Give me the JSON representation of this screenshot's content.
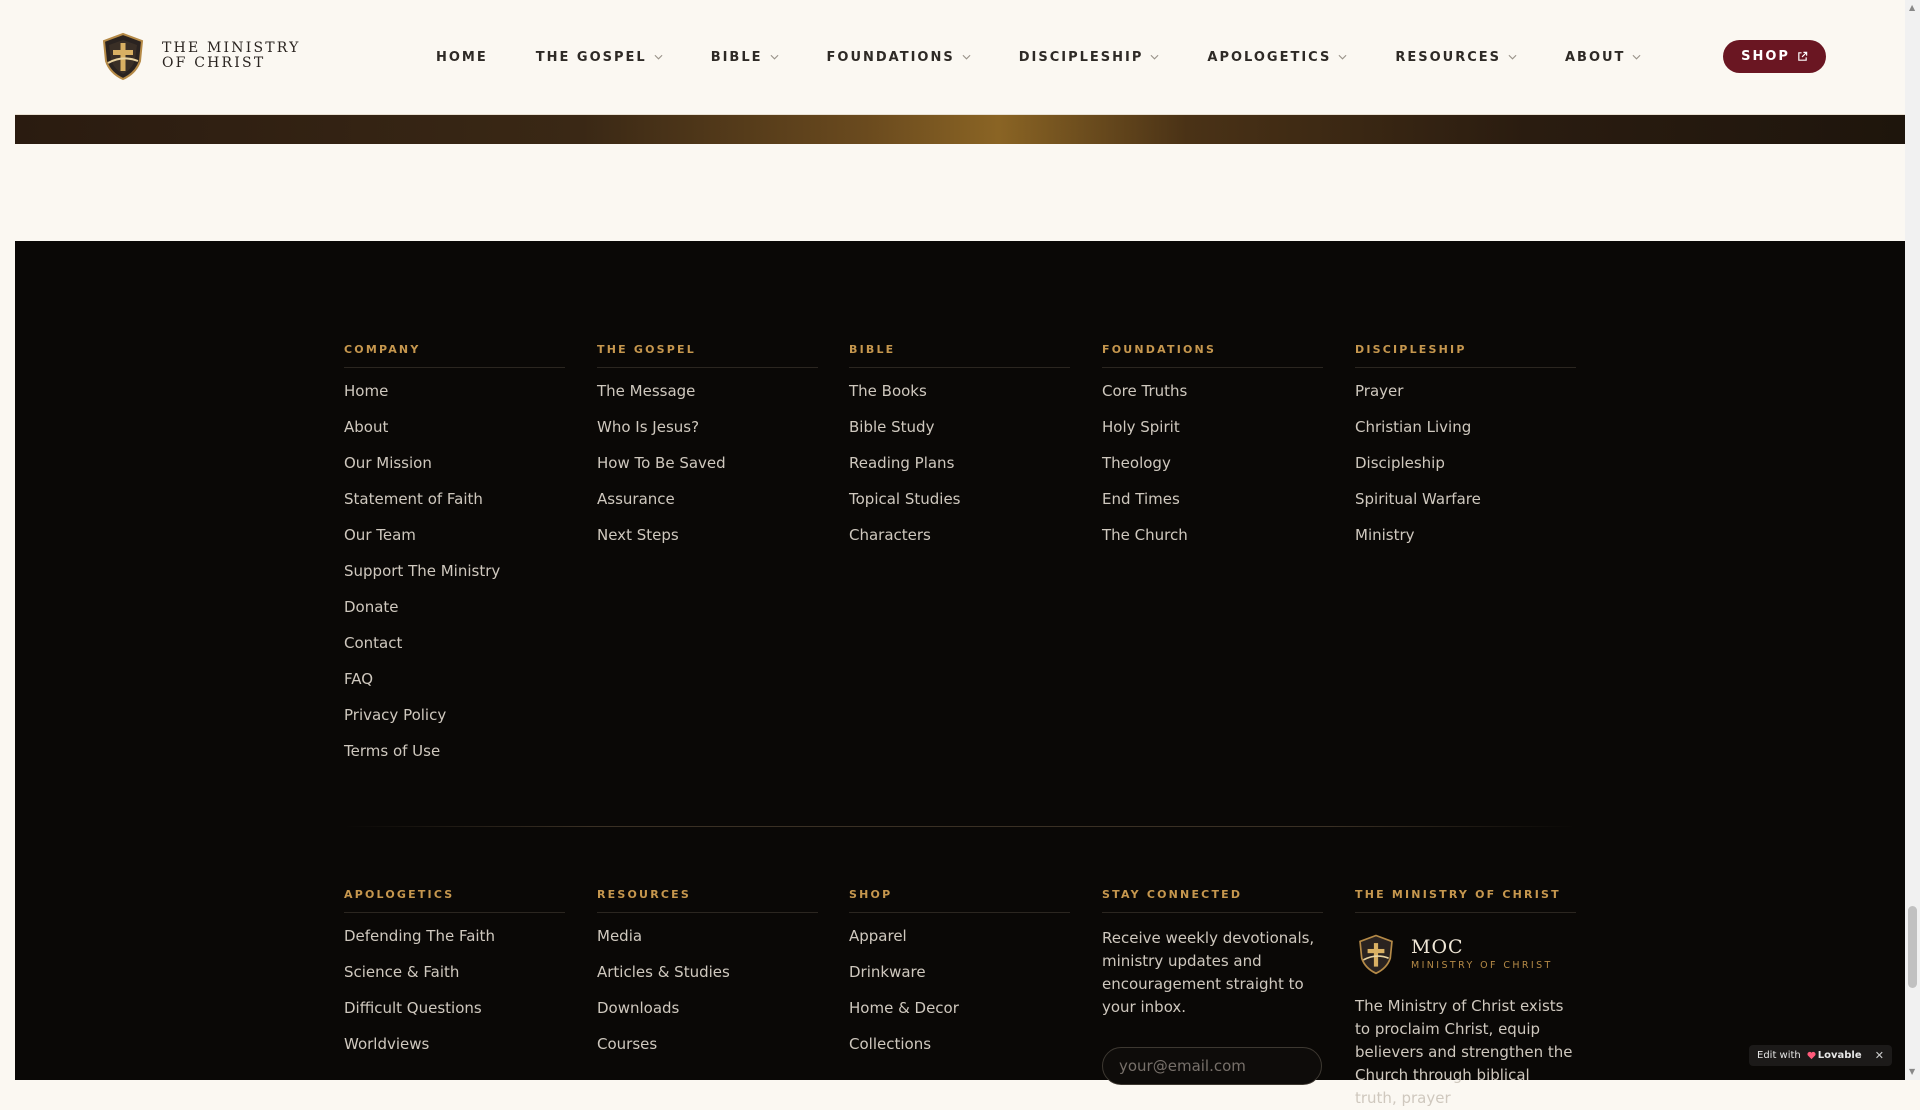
{
  "brand": {
    "name_line1": "THE MINISTRY",
    "name_line2": "OF CHRIST"
  },
  "nav": {
    "items": [
      {
        "label": "HOME",
        "dropdown": false
      },
      {
        "label": "THE GOSPEL",
        "dropdown": true
      },
      {
        "label": "BIBLE",
        "dropdown": true
      },
      {
        "label": "FOUNDATIONS",
        "dropdown": true
      },
      {
        "label": "DISCIPLESHIP",
        "dropdown": true
      },
      {
        "label": "APOLOGETICS",
        "dropdown": true
      },
      {
        "label": "RESOURCES",
        "dropdown": true
      },
      {
        "label": "ABOUT",
        "dropdown": true
      }
    ],
    "shop_label": "SHOP"
  },
  "footer": {
    "row1": [
      {
        "title": "COMPANY",
        "links": [
          "Home",
          "About",
          "Our Mission",
          "Statement of Faith",
          "Our Team",
          "Support The Ministry",
          "Donate",
          "Contact",
          "FAQ",
          "Privacy Policy",
          "Terms of Use"
        ]
      },
      {
        "title": "THE GOSPEL",
        "links": [
          "The Message",
          "Who Is Jesus?",
          "How To Be Saved",
          "Assurance",
          "Next Steps"
        ]
      },
      {
        "title": "BIBLE",
        "links": [
          "The Books",
          "Bible Study",
          "Reading Plans",
          "Topical Studies",
          "Characters"
        ]
      },
      {
        "title": "FOUNDATIONS",
        "links": [
          "Core Truths",
          "Holy Spirit",
          "Theology",
          "End Times",
          "The Church"
        ]
      },
      {
        "title": "DISCIPLESHIP",
        "links": [
          "Prayer",
          "Christian Living",
          "Discipleship",
          "Spiritual Warfare",
          "Ministry"
        ]
      }
    ],
    "row2": [
      {
        "title": "APOLOGETICS",
        "links": [
          "Defending The Faith",
          "Science & Faith",
          "Difficult Questions",
          "Worldviews"
        ]
      },
      {
        "title": "RESOURCES",
        "links": [
          "Media",
          "Articles & Studies",
          "Downloads",
          "Courses"
        ]
      },
      {
        "title": "SHOP",
        "links": [
          "Apparel",
          "Drinkware",
          "Home & Decor",
          "Collections"
        ]
      }
    ],
    "newsletter": {
      "title": "STAY CONNECTED",
      "text": "Receive weekly devotionals, ministry updates and encouragement straight to your inbox.",
      "placeholder": "your@email.com"
    },
    "about": {
      "title": "THE MINISTRY OF CHRIST",
      "logo_title": "MOC",
      "logo_sub": "MINISTRY OF CHRIST",
      "description": "The Ministry of Christ exists to proclaim Christ, equip believers and strengthen the Church through biblical truth, prayer"
    }
  },
  "badge": {
    "prefix": "Edit with",
    "brand": "Lovable",
    "close": "✕"
  },
  "colors": {
    "accent_gold": "#c6974e",
    "shop_button": "#6a1622",
    "footer_bg": "#0a0806",
    "page_bg": "#fbf8f2"
  }
}
